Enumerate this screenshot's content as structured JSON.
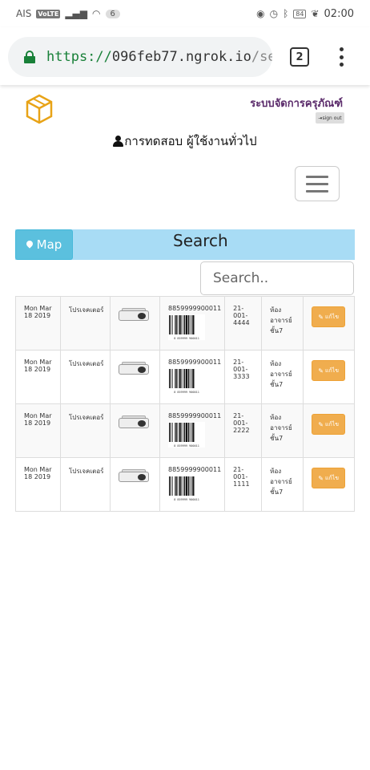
{
  "status_bar": {
    "carrier": "AIS",
    "volte": "VoLTE",
    "notif_count": "6",
    "battery": "84",
    "time": "02:00"
  },
  "browser": {
    "url_scheme": "https://",
    "url_host": "096feb77.ngrok.io",
    "url_path": "/sea",
    "tab_count": "2"
  },
  "header": {
    "app_title": "ระบบจัดการครุภัณฑ์",
    "signout_label": "sign out",
    "user_label": "การทดสอบ ผู้ใช้งานทั่วไป"
  },
  "search": {
    "map_label": "Map",
    "heading": "Search",
    "placeholder": "Search.."
  },
  "rows": [
    {
      "date": "Mon Mar 18 2019",
      "type": "โปรเจคเตอร์",
      "code": "8859999900011",
      "id": "21-001-4444",
      "location": "ห้องอาจารย์ชั้น7",
      "action": "แก้ไข"
    },
    {
      "date": "Mon Mar 18 2019",
      "type": "โปรเจคเตอร์",
      "code": "8859999900011",
      "id": "21-001-3333",
      "location": "ห้องอาจารย์ชั้น7",
      "action": "แก้ไข"
    },
    {
      "date": "Mon Mar 18 2019",
      "type": "โปรเจคเตอร์",
      "code": "8859999900011",
      "id": "21-001-2222",
      "location": "ห้องอาจารย์ชั้น7",
      "action": "แก้ไข"
    },
    {
      "date": "Mon Mar 18 2019",
      "type": "โปรเจคเตอร์",
      "code": "8859999900011",
      "id": "21-001-1111",
      "location": "ห้องอาจารย์ชั้น7",
      "action": "แก้ไข"
    }
  ],
  "colors": {
    "map_button": "#5bc0de",
    "search_banner": "#a8dcf5",
    "edit_button": "#f0ad4e",
    "title_purple": "#5a2a6a",
    "secure_green": "#188038"
  }
}
